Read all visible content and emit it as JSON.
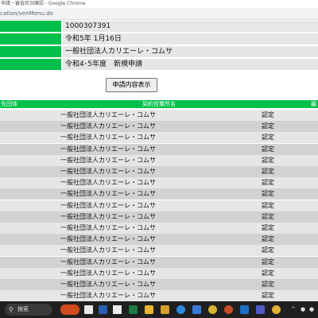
{
  "window": {
    "title": "申請・審査状況確認 - Google Chrome",
    "url": "cation/venMenu.do"
  },
  "info": {
    "rows": [
      {
        "value": "1000307391"
      },
      {
        "value": "令和5年 1月16日"
      },
      {
        "value": "一般社団法人カリエーレ・コムサ"
      },
      {
        "value": "令和4･5年度　新規申請"
      }
    ]
  },
  "actions": {
    "show_application_label": "申請内容表示"
  },
  "grid": {
    "headers": {
      "col1": "先団体",
      "col2": "契約営業所名",
      "col3": "審"
    },
    "rows": [
      {
        "name": "一般社団法人カリエーレ・コムサ",
        "status": "認定"
      },
      {
        "name": "一般社団法人カリエーレ・コムサ",
        "status": "認定"
      },
      {
        "name": "一般社団法人カリエーレ・コムサ",
        "status": "認定"
      },
      {
        "name": "一般社団法人カリエーレ・コムサ",
        "status": "認定"
      },
      {
        "name": "一般社団法人カリエーレ・コムサ",
        "status": "認定"
      },
      {
        "name": "一般社団法人カリエーレ・コムサ",
        "status": "認定"
      },
      {
        "name": "一般社団法人カリエーレ・コムサ",
        "status": "認定"
      },
      {
        "name": "一般社団法人カリエーレ・コムサ",
        "status": "認定"
      },
      {
        "name": "一般社団法人カリエーレ・コムサ",
        "status": "認定"
      },
      {
        "name": "一般社団法人カリエーレ・コムサ",
        "status": "認定"
      },
      {
        "name": "一般社団法人カリエーレ・コムサ",
        "status": "認定"
      },
      {
        "name": "一般社団法人カリエーレ・コムサ",
        "status": "認定"
      },
      {
        "name": "一般社団法人カリエーレ・コムサ",
        "status": "認定"
      },
      {
        "name": "一般社団法人カリエーレ・コムサ",
        "status": "認定"
      },
      {
        "name": "一般社団法人カリエーレ・コムサ",
        "status": "認定"
      },
      {
        "name": "一般社団法人カリエーレ・コムサ",
        "status": "認定"
      },
      {
        "name": "一般社団法人カリエーレ・コムサ",
        "status": "認定"
      }
    ]
  },
  "taskbar": {
    "search_label": "検索",
    "search_icon": "search-icon",
    "apps": [
      "widget-icon",
      "file-explorer-icon",
      "word-icon",
      "excel-icon",
      "folder-icon",
      "edge-icon",
      "mail-icon",
      "chrome-icon",
      "powerpoint-icon",
      "outlook-icon",
      "teams-icon",
      "chrome-icon"
    ]
  },
  "colors": {
    "green_header": "#00c04b",
    "row_light": "#e6e6e6",
    "row_dark": "#d2d2d2",
    "taskbar": "#1f1f1f"
  }
}
